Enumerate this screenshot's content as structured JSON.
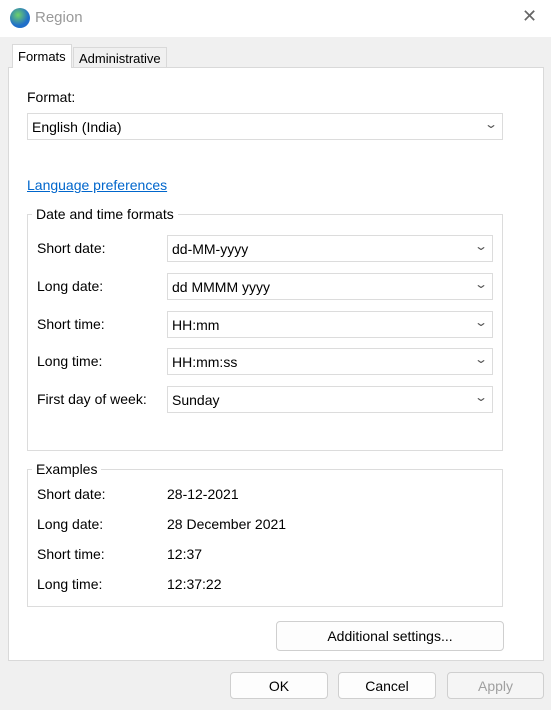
{
  "window": {
    "title": "Region",
    "icon": "globe-clock-icon"
  },
  "tabs": [
    {
      "label": "Formats",
      "selected": true
    },
    {
      "label": "Administrative",
      "selected": false
    }
  ],
  "format": {
    "label": "Format:",
    "value": "English (India)"
  },
  "language_link": "Language preferences",
  "date_time": {
    "legend": "Date and time formats",
    "rows": [
      {
        "label": "Short date:",
        "value": "dd-MM-yyyy"
      },
      {
        "label": "Long date:",
        "value": "dd MMMM yyyy"
      },
      {
        "label": "Short time:",
        "value": "HH:mm"
      },
      {
        "label": "Long time:",
        "value": "HH:mm:ss"
      },
      {
        "label": "First day of week:",
        "value": "Sunday"
      }
    ]
  },
  "examples": {
    "legend": "Examples",
    "rows": [
      {
        "label": "Short date:",
        "value": "28-12-2021"
      },
      {
        "label": "Long date:",
        "value": "28 December 2021"
      },
      {
        "label": "Short time:",
        "value": "12:37"
      },
      {
        "label": "Long time:",
        "value": "12:37:22"
      }
    ]
  },
  "buttons": {
    "additional": "Additional settings...",
    "ok": "OK",
    "cancel": "Cancel",
    "apply": "Apply"
  }
}
